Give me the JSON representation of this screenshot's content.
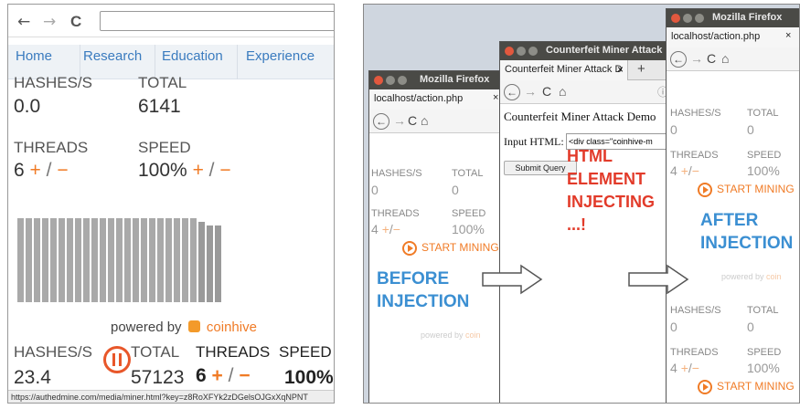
{
  "left": {
    "nav": {
      "back": "←",
      "forward": "→",
      "reload": "C"
    },
    "menu": [
      "Home",
      "Research",
      "Education",
      "Experience"
    ],
    "top_stats": {
      "hashes_label": "HASHES/S",
      "hashes_value": "0.0",
      "total_label": "TOTAL",
      "total_value": "6141",
      "threads_label": "THREADS",
      "threads_value": "6",
      "speed_label": "SPEED",
      "speed_value": "100%",
      "plus": "+",
      "slash": "/",
      "minus": "−"
    },
    "powered_by": "powered by",
    "brand": "coinhive",
    "bottom_stats": {
      "hashes_label": "HASHES/S",
      "hashes_value": "23.4",
      "total_label": "TOTAL",
      "total_value": "57123",
      "threads_label": "THREADS",
      "threads_value": "6",
      "speed_label": "SPEED",
      "speed_value": "100%"
    },
    "status_url": "https://authedmine.com/media/miner.html?key=z8RoXFYk2zDGelsOJGxXqNPNT"
  },
  "right": {
    "win1": {
      "title": "Mozilla Firefox",
      "tab": "localhost/action.php",
      "tab_close": "×",
      "hashes_label": "HASHES/S",
      "hashes_value": "0",
      "total_label": "TOTAL",
      "total_value": "0",
      "threads_label": "THREADS",
      "threads_value": "4",
      "speed_label": "SPEED",
      "speed_value": "100%",
      "start": "START MINING",
      "powered": "powered by",
      "brand": "coin"
    },
    "win2": {
      "title": "Counterfeit Miner Attack D",
      "tab": "Counterfeit Miner Attack D",
      "tab_close": "×",
      "newtab": "+",
      "page_title": "Counterfeit Miner Attack Demo",
      "input_label": "Input HTML:",
      "input_value": "<div class=\"coinhive-m",
      "submit": "Submit Query"
    },
    "win3": {
      "title": "Mozilla Firefox",
      "tab": "localhost/action.php",
      "tab_close": "×",
      "hashes_label": "HASHES/S",
      "hashes_value": "0",
      "total_label": "TOTAL",
      "total_value": "0",
      "threads_label": "THREADS",
      "threads_value": "4",
      "speed_label": "SPEED",
      "speed_value": "100%",
      "start": "START MINING",
      "powered": "powered by",
      "brand": "coin",
      "hashes2_label": "HASHES/S",
      "hashes2_value": "0",
      "total2_label": "TOTAL",
      "total2_value": "0",
      "threads2_label": "THREADS",
      "threads2_value": "4",
      "speed2_label": "SPEED",
      "speed2_value": "100%",
      "start2": "START MINING"
    },
    "annotations": {
      "before1": "BEFORE",
      "before2": "INJECTION",
      "html1": "HTML",
      "html2": "ELEMENT",
      "html3": "INJECTING",
      "html4": "...!",
      "after1": "AFTER",
      "after2": "INJECTION"
    }
  }
}
